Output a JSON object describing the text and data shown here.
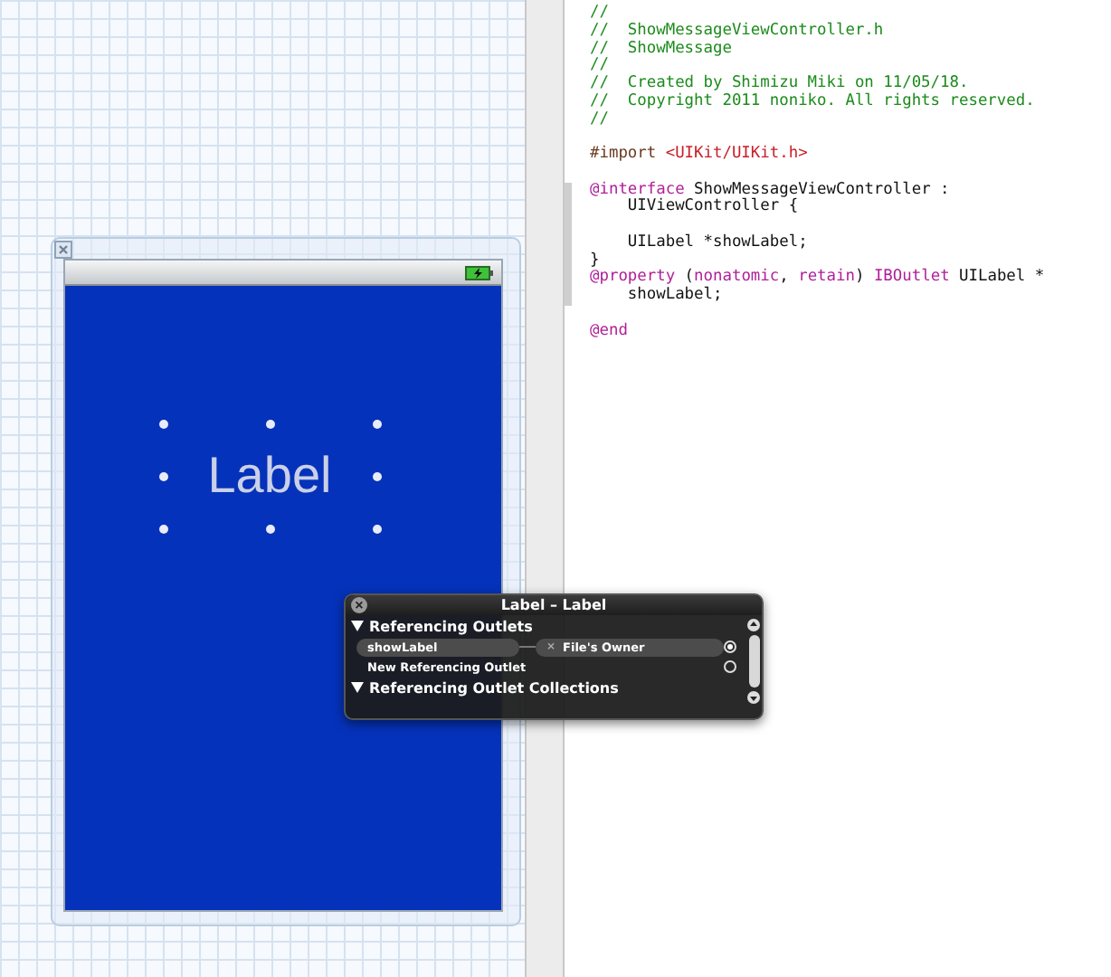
{
  "canvas": {
    "device": {
      "status_bar": {
        "charging": true
      },
      "label": {
        "text": "Label",
        "selected": true
      }
    }
  },
  "inspector": {
    "title": "Label – Label",
    "close": "×",
    "sections": [
      {
        "title": "Referencing Outlets",
        "expanded": true,
        "rows": [
          {
            "name": "showLabel",
            "target": "File's Owner",
            "remove": "×",
            "connected": true
          },
          {
            "name": "New Referencing Outlet",
            "connected": false
          }
        ]
      },
      {
        "title": "Referencing Outlet Collections",
        "expanded": true
      }
    ]
  },
  "editor": {
    "lines": [
      {
        "in_scope": false,
        "parts": [
          {
            "kind": "comment",
            "text": "//"
          }
        ]
      },
      {
        "in_scope": false,
        "parts": [
          {
            "kind": "comment",
            "text": "//  ShowMessageViewController.h"
          }
        ]
      },
      {
        "in_scope": false,
        "parts": [
          {
            "kind": "comment",
            "text": "//  ShowMessage"
          }
        ]
      },
      {
        "in_scope": false,
        "parts": [
          {
            "kind": "comment",
            "text": "//"
          }
        ]
      },
      {
        "in_scope": false,
        "parts": [
          {
            "kind": "comment",
            "text": "//  Created by Shimizu Miki on 11/05/18."
          }
        ]
      },
      {
        "in_scope": false,
        "parts": [
          {
            "kind": "comment",
            "text": "//  Copyright 2011 noniko. All rights reserved."
          }
        ]
      },
      {
        "in_scope": false,
        "parts": [
          {
            "kind": "comment",
            "text": "//"
          }
        ]
      },
      {
        "in_scope": false
      },
      {
        "in_scope": false,
        "parts": [
          {
            "kind": "directive",
            "text": "#import "
          },
          {
            "kind": "string",
            "text": "<UIKit/UIKit.h>"
          }
        ]
      },
      {
        "in_scope": false
      },
      {
        "in_scope": true,
        "parts": [
          {
            "kind": "keyword",
            "text": "@interface"
          },
          {
            "kind": "plain",
            "text": " ShowMessageViewController :"
          }
        ]
      },
      {
        "in_scope": true,
        "parts": [
          {
            "kind": "plain",
            "text": "    UIViewController {"
          }
        ]
      },
      {
        "in_scope": true
      },
      {
        "in_scope": true,
        "parts": [
          {
            "kind": "plain",
            "text": "    UILabel *showLabel;"
          }
        ]
      },
      {
        "in_scope": true,
        "parts": [
          {
            "kind": "plain",
            "text": "}"
          }
        ]
      },
      {
        "in_scope": true,
        "parts": [
          {
            "kind": "keyword",
            "text": "@property"
          },
          {
            "kind": "plain",
            "text": " ("
          },
          {
            "kind": "keyword",
            "text": "nonatomic"
          },
          {
            "kind": "plain",
            "text": ", "
          },
          {
            "kind": "keyword",
            "text": "retain"
          },
          {
            "kind": "plain",
            "text": ") "
          },
          {
            "kind": "keyword",
            "text": "IBOutlet"
          },
          {
            "kind": "plain",
            "text": " UILabel *"
          }
        ]
      },
      {
        "in_scope": true,
        "parts": [
          {
            "kind": "plain",
            "text": "    showLabel;"
          }
        ]
      },
      {
        "in_scope": false
      },
      {
        "in_scope": false,
        "parts": [
          {
            "kind": "keyword",
            "text": "@end"
          }
        ]
      }
    ]
  }
}
